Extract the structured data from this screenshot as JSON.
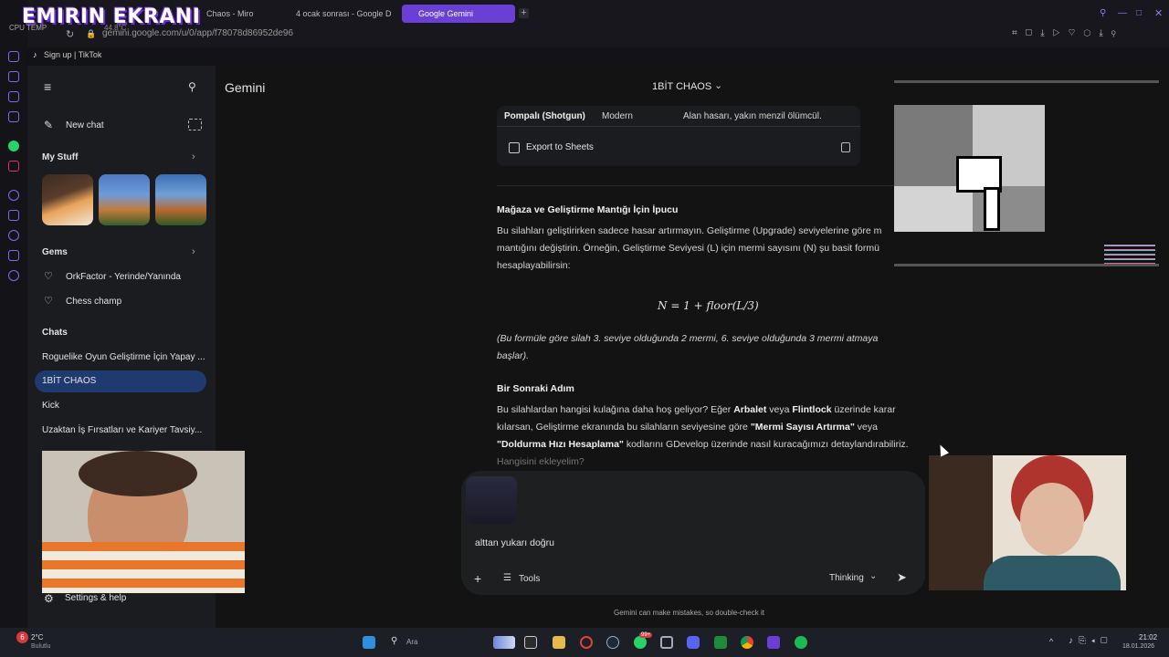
{
  "overlay": {
    "title": "EMIRIN EKRANI",
    "cpu_label": "CPU TEMP",
    "cpu_value": "44.8°C"
  },
  "browser": {
    "tabs": [
      {
        "label": "Chaos - Miro"
      },
      {
        "label": "4 ocak sonrası - Google D"
      },
      {
        "label": "Google Gemini"
      }
    ],
    "url": "gemini.google.com/u/0/app/f78078d86952de96",
    "bookmarks": [
      "Sign up | TikTok"
    ]
  },
  "sidebar": {
    "new_chat": "New chat",
    "my_stuff": "My Stuff",
    "gems_heading": "Gems",
    "gems": [
      "OrkFactor - Yerinde/Yanında",
      "Chess champ"
    ],
    "chats_heading": "Chats",
    "chats": [
      "Roguelike Oyun Geliştirme İçin Yapay ...",
      "1BİT CHAOS",
      "Kick",
      "Uzaktan İş Fırsatları ve Kariyer Tavsiy..."
    ],
    "settings": "Settings & help"
  },
  "header": {
    "app_name": "Gemini",
    "chat_title": "1BİT CHAOS"
  },
  "table": {
    "row": [
      "Pompalı (Shotgun)",
      "Modern",
      "Alan hasarı, yakın menzil ölümcül."
    ],
    "export_label": "Export to Sheets"
  },
  "content": {
    "section1_title": "Mağaza ve Geliştirme Mantığı İçin İpucu",
    "section1_body": "Bu silahları geliştirirken sadece hasar artırmayın. Geliştirme (Upgrade) seviyelerine göre m mantığını değiştirin. Örneğin, Geliştirme Seviyesi (L) için mermi sayısını (N) şu basit formü hesaplayabilirsin:",
    "formula": "N = 1 + floor(L/3)",
    "formula_note": "(Bu formüle göre silah 3. seviye olduğunda 2 mermi, 6. seviye olduğunda 3 mermi atmaya başlar).",
    "section2_title": "Bir Sonraki Adım",
    "section2_p1": "Bu silahlardan hangisi kulağına daha hoş geliyor? Eğer ",
    "arbalet": "Arbalet",
    "veya": " veya ",
    "flintlock": "Flintlock",
    "p2": " üzerinde karar kılarsan, Geliştirme ekranında bu silahların seviyesine göre ",
    "mermi": "\"Mermi Sayısı Artırma\"",
    "veya2": " veya ",
    "doldurma": "\"Doldurma Hızı Hesaplama\"",
    "p3": " kodlarını GDevelop üzerinde nasıl kuracağımızı detaylandırabiliriz.",
    "p4": "Hangisini ekleyelim?"
  },
  "input": {
    "text": "alttan yukarı doğru",
    "tools": "Tools",
    "mode": "Thinking",
    "disclaimer": "Gemini can make mistakes, so double-check it"
  },
  "taskbar": {
    "weather_temp": "2°C",
    "weather_desc": "Bulutlu",
    "search_placeholder": "Ara",
    "time": "21:02",
    "date": "18.01.2026",
    "badge_count": "6",
    "whatsapp_badge": "99+"
  },
  "colors": {
    "accent": "#6a3fd6",
    "active_chat": "#1e3a6e",
    "background": "#131314"
  }
}
